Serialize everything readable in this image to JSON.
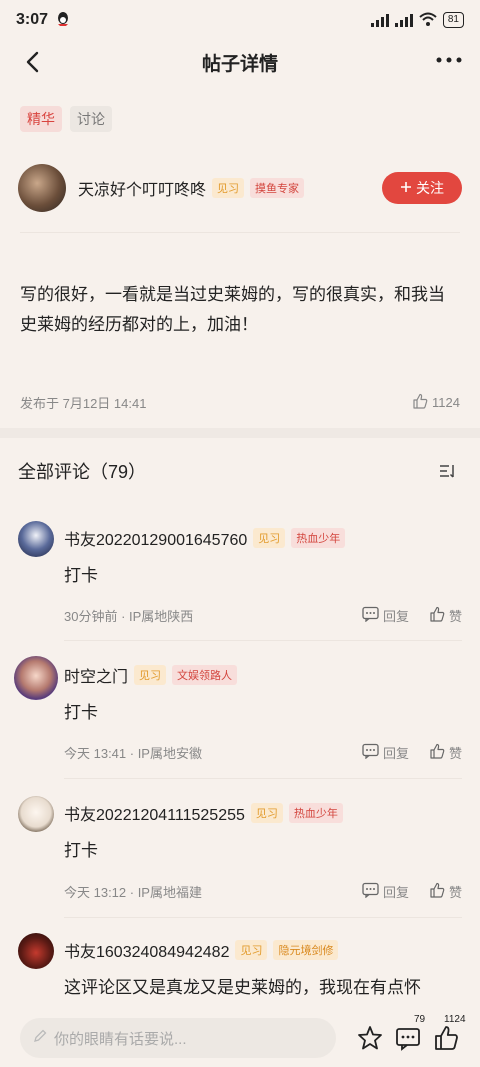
{
  "status": {
    "time": "3:07",
    "battery": "81"
  },
  "header": {
    "title": "帖子详情"
  },
  "tags": [
    "精华",
    "讨论"
  ],
  "author": {
    "name": "天凉好个叮叮咚咚",
    "badge1": "见习",
    "badge2": "摸鱼专家",
    "follow_label": "关注"
  },
  "post": {
    "text": "写的很好，一看就是当过史莱姆的，写的很真实，和我当史莱姆的经历都对的上，加油！",
    "published": "发布于 7月12日 14:41",
    "likes": "1124"
  },
  "comments_header": {
    "title": "全部评论（79）"
  },
  "comments": [
    {
      "name": "书友20220129001645760",
      "badge1": "见习",
      "badge2": "热血少年",
      "text": "打卡",
      "meta": "30分钟前 · IP属地陕西",
      "reply": "回复",
      "like": "赞"
    },
    {
      "name": "时空之门",
      "badge1": "见习",
      "badge2": "文娱领路人",
      "text": "打卡",
      "meta": "今天 13:41 · IP属地安徽",
      "reply": "回复",
      "like": "赞"
    },
    {
      "name": "书友20221204111525255",
      "badge1": "见习",
      "badge2": "热血少年",
      "text": "打卡",
      "meta": "今天 13:12 · IP属地福建",
      "reply": "回复",
      "like": "赞"
    },
    {
      "name": "书友160324084942482",
      "badge1": "见习",
      "badge2": "隐元境剑修",
      "text": "这评论区又是真龙又是史莱姆的，我现在有点怀",
      "meta": "",
      "reply": "",
      "like": ""
    }
  ],
  "bottom": {
    "placeholder": "你的眼睛有话要说...",
    "comment_count": "79",
    "like_count": "1124"
  },
  "colors": {
    "accent": "#e2473f",
    "background": "#f7f1ec"
  }
}
